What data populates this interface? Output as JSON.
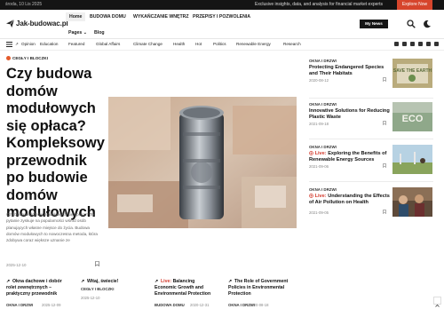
{
  "topbar": {
    "date": "środa, 10 Lis 2025",
    "promo": "Exclusive insights, data, and analysis for financial market experts",
    "explore_label": "Explore Now"
  },
  "header": {
    "logo_text": "Jak-budowac.pl",
    "nav": [
      "Home",
      "BUDOWA DOMU",
      "WYKAŃCZANIE WNĘTRZ",
      "PRZEPISY I POZWOLENIA",
      "Pages",
      "Blog"
    ],
    "news_button": "My News"
  },
  "categories": [
    "Opinion",
    "Education",
    "Featured",
    "Global Affairs",
    "Climate Change",
    "Health",
    "Hot",
    "Politics",
    "Renewable Energy",
    "Research"
  ],
  "hero": {
    "category": "CEGŁY I BLOCZKI",
    "title": "Czy budowa domów modułowych się opłaca? Kompleksowy przewodnik po budowie domów modułowych",
    "excerpt": "Czy budowa domów modułowych się opłaca? To pytanie zyskuje na popularności wśród osób planujących własne miejsce do życia. Budowa domów modułowych to nowoczesna metoda, która zdobywa coraz większe uznanie ze",
    "date": "2025-12-10"
  },
  "side_articles": [
    {
      "category": "OKNA I DRZWI",
      "live": "",
      "title": "Protecting Endangered Species and Their Habitats",
      "date": "2020-08-12",
      "thumb_text": "SAVE THE EARTH"
    },
    {
      "category": "OKNA I DRZWI",
      "live": "",
      "title": "Innovative Solutions for Reducing Plastic Waste",
      "date": "2021-09-18",
      "thumb_text": "ECO"
    },
    {
      "category": "OKNA I DRZWI",
      "live": "Live:",
      "title": "Exploring the Benefits of Renewable Energy Sources",
      "date": "2021-09-06",
      "thumb_text": ""
    },
    {
      "category": "OKNA I DRZWI",
      "live": "Live:",
      "title": "Understanding the Effects of Air Pollution on Health",
      "date": "2021-09-05",
      "thumb_text": ""
    }
  ],
  "bottom_articles": [
    {
      "title1": "Okna dachowe i dobór",
      "title2": "rolet zewnętrznych –",
      "title3": "praktyczny przewodnik",
      "category": "OKNA I DRZWI",
      "date": "2025-12-09"
    },
    {
      "title1": "Witaj, świecie!",
      "title2": "",
      "title3": "",
      "category": "CEGŁY I BLOCZKI",
      "date": "2025-12-10"
    },
    {
      "live": "Live:",
      "title1": "Balancing",
      "title2": "Economic Growth and",
      "title3": "Environmental Protection",
      "category": "BUDOWA DOMU",
      "date": "2020-12-31"
    },
    {
      "title1": "The Role of Government",
      "title2": "Policies in Environmental",
      "title3": "Protection",
      "category": "OKNA I DRZWI",
      "date": "2020-08-18"
    }
  ],
  "colors": {
    "accent": "#d6452c",
    "live": "#d33a2c",
    "dark": "#141414"
  }
}
